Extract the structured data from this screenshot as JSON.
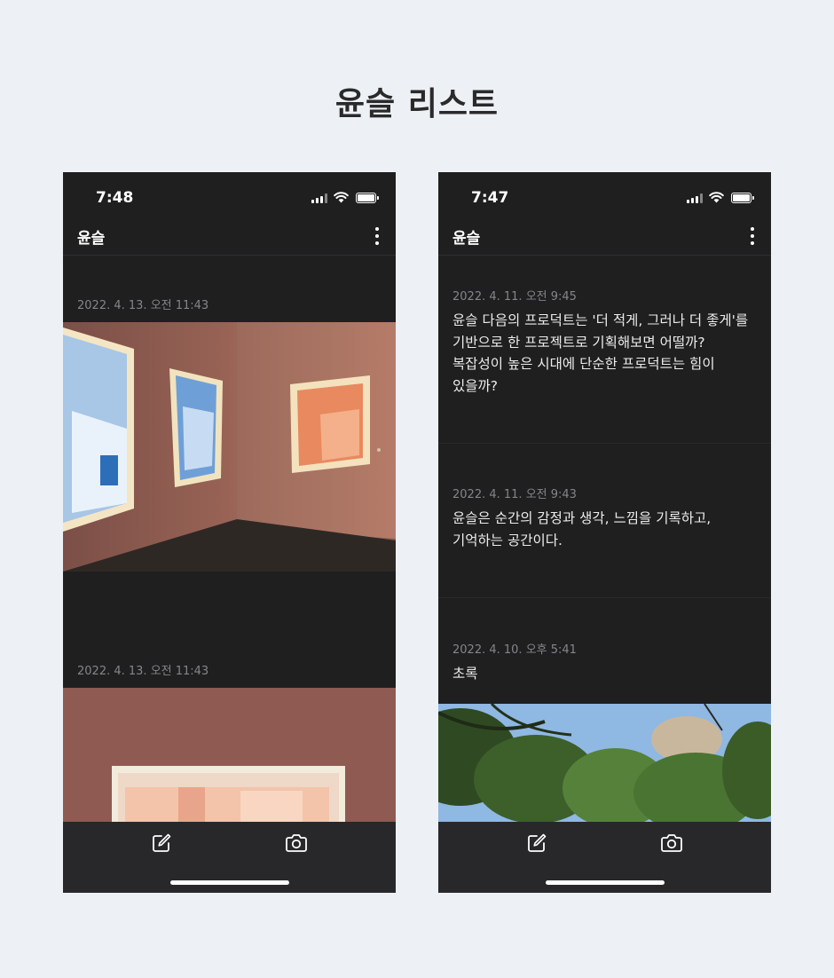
{
  "page": {
    "title": "윤슬 리스트"
  },
  "left_phone": {
    "status_time": "7:48",
    "app_title": "윤슬",
    "posts": [
      {
        "date": "2022. 4. 13. 오전 11:43",
        "photo": "gallery-room-with-framed-artworks"
      },
      {
        "date": "2022. 4. 13. 오전 11:43",
        "photo": "framed-pink-staircase-artwork"
      }
    ]
  },
  "right_phone": {
    "status_time": "7:47",
    "app_title": "윤슬",
    "posts": [
      {
        "date": "2022. 4. 11. 오전 9:45",
        "text": "윤슬 다음의 프로덕트는 '더 적게, 그러나 더 좋게'를\n기반으로 한 프로젝트로 기획해보면 어떨까?\n복잡성이 높은 시대에 단순한 프로덕트는 힘이\n있을까?"
      },
      {
        "date": "2022. 4. 11. 오전 9:43",
        "text": "윤슬은 순간의 감정과 생각, 느낌을 기록하고,\n기억하는 공간이다."
      },
      {
        "date": "2022. 4. 10. 오후 5:41",
        "text": "초록",
        "photo": "pine-trees-against-blue-sky"
      }
    ]
  },
  "icons": {
    "status": [
      "signal-icon",
      "wifi-icon",
      "battery-icon"
    ],
    "app_bar": "more-vertical-icon",
    "bottom_bar": [
      "compose-icon",
      "camera-icon"
    ]
  },
  "colors": {
    "page_background": "#edf1f6",
    "phone_background": "#1f1f20",
    "bottom_bar": "#28282a",
    "date_text": "#85858a",
    "body_text": "#ececec"
  }
}
